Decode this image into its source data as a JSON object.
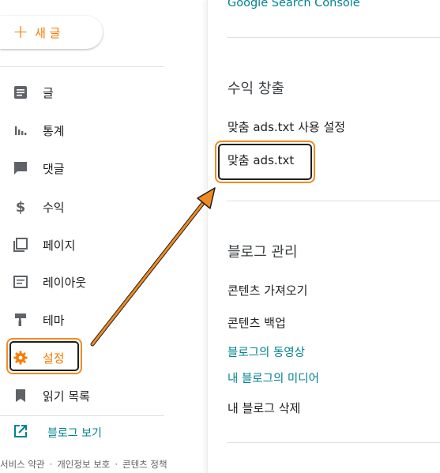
{
  "sidebar": {
    "new_post_label": "새 글",
    "items": [
      {
        "label": "글",
        "icon": "posts-icon"
      },
      {
        "label": "통계",
        "icon": "stats-icon"
      },
      {
        "label": "댓글",
        "icon": "comments-icon"
      },
      {
        "label": "수익",
        "icon": "dollar-icon"
      },
      {
        "label": "페이지",
        "icon": "pages-icon"
      },
      {
        "label": "레이아웃",
        "icon": "layout-icon"
      },
      {
        "label": "테마",
        "icon": "theme-icon"
      },
      {
        "label": "설정",
        "icon": "gear-icon"
      },
      {
        "label": "읽기 목록",
        "icon": "bookmark-icon"
      }
    ],
    "view_blog_label": "블로그 보기",
    "footer": [
      "서비스 약관",
      "개인정보 보호",
      "콘텐츠 정책"
    ]
  },
  "right_panel": {
    "top_link": "Google Search Console",
    "sections": [
      {
        "heading": "수익 창출",
        "items": [
          "맞춤 ads.txt 사용 설정",
          "맞춤 ads.txt"
        ]
      },
      {
        "heading": "블로그 관리",
        "items": [
          "콘텐츠 가져오기",
          "콘텐츠 백업",
          "블로그의 동영상",
          "내 블로그의 미디어",
          "내 블로그 삭제"
        ]
      }
    ]
  },
  "colors": {
    "accent": "#f57c00",
    "link": "#00838f",
    "highlight_outline": "#f08a23",
    "arrow": "#f08a23"
  }
}
